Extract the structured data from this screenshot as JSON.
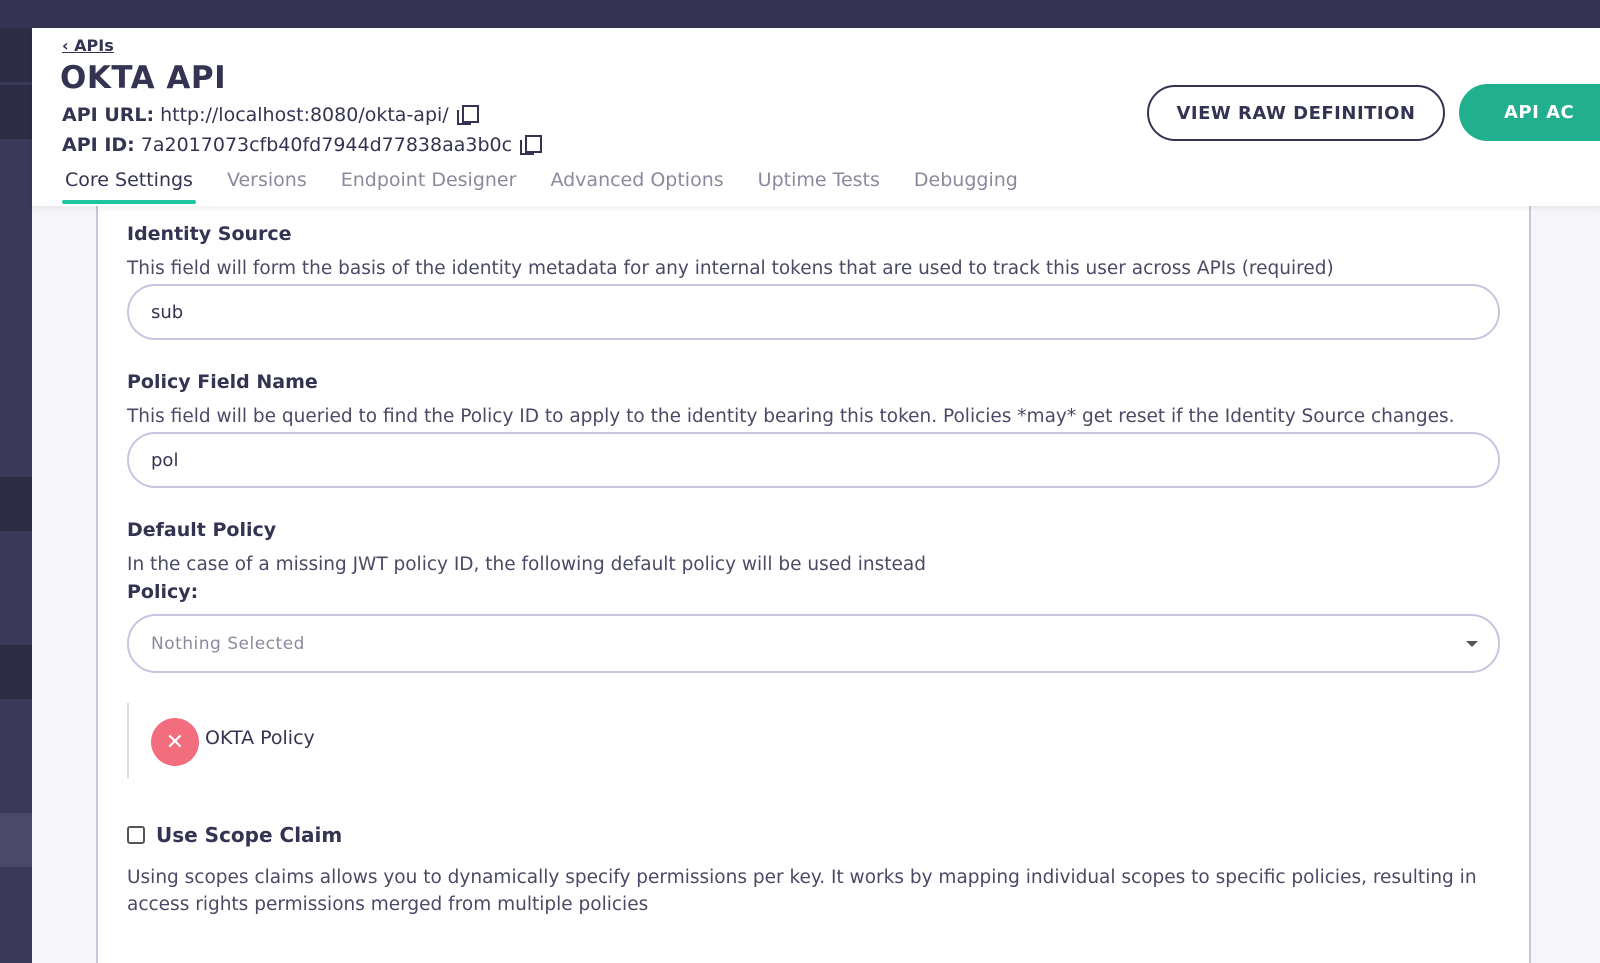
{
  "header": {
    "back_link": "APIs",
    "back_chevron": "‹",
    "title": "OKTA API",
    "api_url_label": "API URL:",
    "api_url_value": "http://localhost:8080/okta-api/",
    "api_id_label": "API ID:",
    "api_id_value": "7a2017073cfb40fd7944d77838aa3b0c",
    "view_raw_button": "VIEW RAW DEFINITION",
    "primary_button": "API AC"
  },
  "tabs": [
    {
      "label": "Core Settings",
      "active": true
    },
    {
      "label": "Versions",
      "active": false
    },
    {
      "label": "Endpoint Designer",
      "active": false
    },
    {
      "label": "Advanced Options",
      "active": false
    },
    {
      "label": "Uptime Tests",
      "active": false
    },
    {
      "label": "Debugging",
      "active": false
    }
  ],
  "identity_source": {
    "label": "Identity Source",
    "help": "This field will form the basis of the identity metadata for any internal tokens that are used to track this user across APIs (required)",
    "value": "sub"
  },
  "policy_field": {
    "label": "Policy Field Name",
    "help": "This field will be queried to find the Policy ID to apply to the identity bearing this token. Policies *may* get reset if the Identity Source changes.",
    "value": "pol"
  },
  "default_policy": {
    "label": "Default Policy",
    "help": "In the case of a missing JWT policy ID, the following default policy will be used instead",
    "select_label": "Policy:",
    "select_value": "Nothing Selected",
    "selected_policies": [
      {
        "name": "OKTA Policy",
        "remove_glyph": "✕"
      }
    ]
  },
  "scope_claim": {
    "label": "Use Scope Claim",
    "checked": false,
    "help": "Using scopes claims allows you to dynamically specify permissions per key. It works by mapping individual scopes to specific policies, resulting in access rights permissions merged from multiple policies"
  },
  "colors": {
    "topbar": "#343452",
    "accent": "#20c5a0",
    "primary_button": "#20b08e",
    "remove": "#f26d7d"
  }
}
